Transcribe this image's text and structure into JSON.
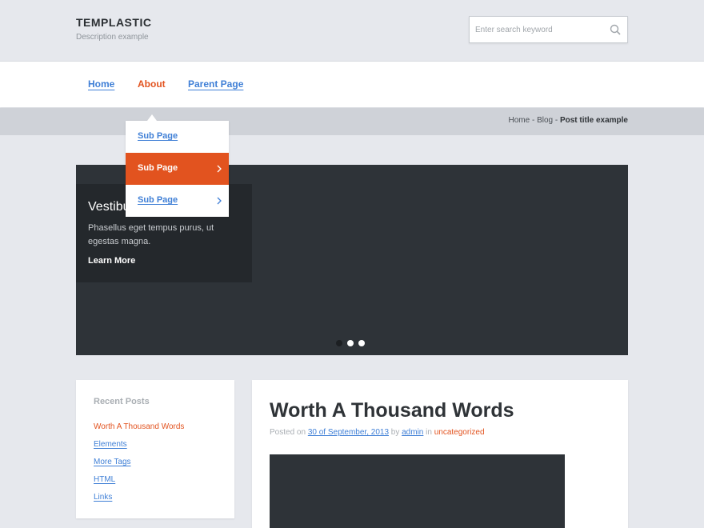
{
  "header": {
    "site_title": "TEMPLASTIC",
    "site_description": "Description example",
    "search_placeholder": "Enter search keyword"
  },
  "nav": {
    "items": [
      {
        "label": "Home"
      },
      {
        "label": "About"
      },
      {
        "label": "Parent Page"
      }
    ],
    "active_index": 1,
    "dropdown": [
      {
        "label": "Sub Page"
      },
      {
        "label": "Sub Page"
      },
      {
        "label": "Sub Page"
      }
    ]
  },
  "breadcrumb": {
    "home": "Home",
    "sep1": " - ",
    "blog": "Blog",
    "sep2": " - ",
    "current": "Post title example"
  },
  "slider": {
    "caption_title": "Vestibulum Lorem Ipsum",
    "caption_text": "Phasellus eget tempus purus, ut egestas magna.",
    "caption_link": "Learn More",
    "dot_count": 3,
    "active_dot": 0
  },
  "sidebar": {
    "widget_title": "Recent Posts",
    "items": [
      {
        "label": "Worth A Thousand Words"
      },
      {
        "label": "Elements"
      },
      {
        "label": "More Tags"
      },
      {
        "label": "HTML"
      },
      {
        "label": "Links"
      }
    ]
  },
  "post": {
    "title": "Worth A Thousand Words",
    "meta_posted_on": "Posted on ",
    "meta_date": "30 of September, 2013",
    "meta_by": " by ",
    "meta_author": "admin",
    "meta_in": " in ",
    "meta_category": "uncategorized"
  },
  "colors": {
    "accent": "#e2531f",
    "link": "#3f7fd6",
    "dark": "#2e3338",
    "background": "#e6e8ed"
  }
}
